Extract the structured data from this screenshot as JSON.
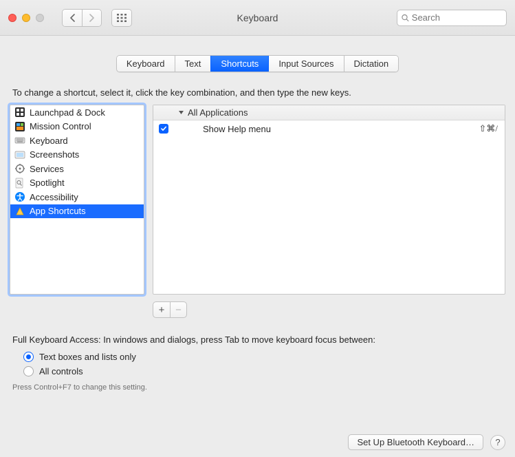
{
  "window": {
    "title": "Keyboard",
    "search_placeholder": "Search"
  },
  "tabs": [
    {
      "label": "Keyboard",
      "active": false
    },
    {
      "label": "Text",
      "active": false
    },
    {
      "label": "Shortcuts",
      "active": true
    },
    {
      "label": "Input Sources",
      "active": false
    },
    {
      "label": "Dictation",
      "active": false
    }
  ],
  "instruction": "To change a shortcut, select it, click the key combination, and then type the new keys.",
  "categories": [
    {
      "label": "Launchpad & Dock",
      "icon": "launchpad-icon"
    },
    {
      "label": "Mission Control",
      "icon": "mission-control-icon"
    },
    {
      "label": "Keyboard",
      "icon": "keyboard-icon"
    },
    {
      "label": "Screenshots",
      "icon": "screenshots-icon"
    },
    {
      "label": "Services",
      "icon": "services-icon"
    },
    {
      "label": "Spotlight",
      "icon": "spotlight-icon"
    },
    {
      "label": "Accessibility",
      "icon": "accessibility-icon"
    },
    {
      "label": "App Shortcuts",
      "icon": "app-shortcuts-icon",
      "selected": true
    }
  ],
  "shortcut_group": {
    "header": "All Applications",
    "items": [
      {
        "enabled": true,
        "label": "Show Help menu",
        "keys": "⇧⌘/"
      }
    ]
  },
  "buttons": {
    "add": "+",
    "remove": "−"
  },
  "full_keyboard_access": {
    "prompt": "Full Keyboard Access: In windows and dialogs, press Tab to move keyboard focus between:",
    "options": [
      {
        "label": "Text boxes and lists only",
        "checked": true
      },
      {
        "label": "All controls",
        "checked": false
      }
    ],
    "hint": "Press Control+F7 to change this setting."
  },
  "footer": {
    "bluetooth": "Set Up Bluetooth Keyboard…",
    "help": "?"
  }
}
